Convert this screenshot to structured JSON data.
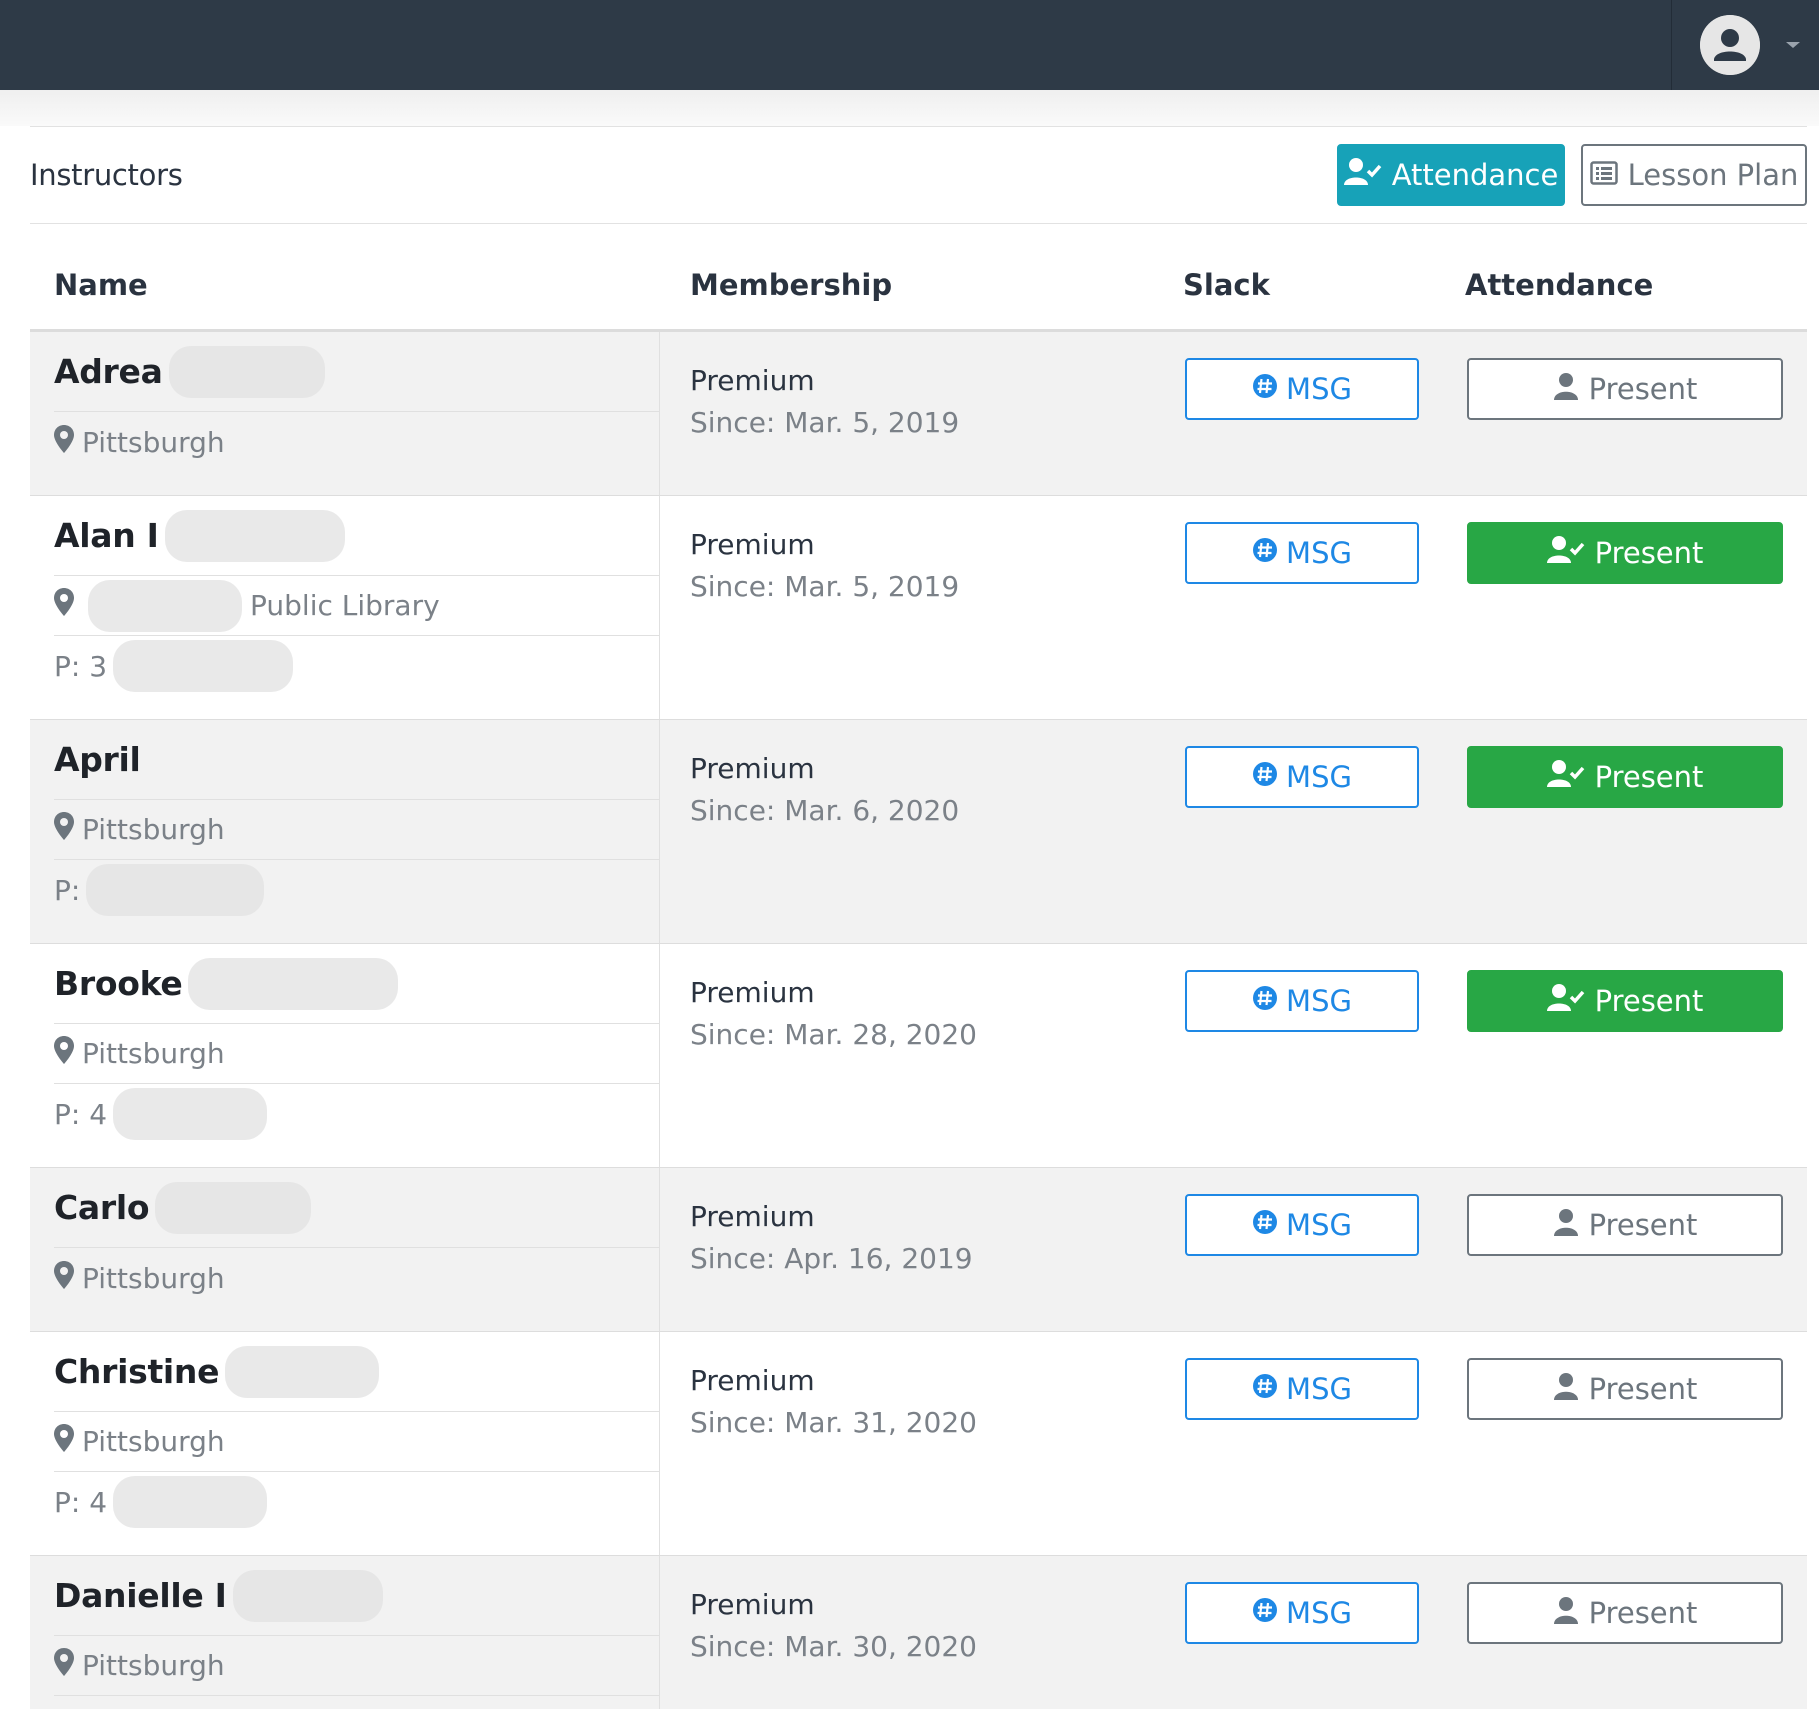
{
  "header": {
    "user_menu": "user-avatar"
  },
  "section": {
    "title": "Instructors",
    "attendance_button": "Attendance",
    "lesson_plan_button": "Lesson Plan"
  },
  "table": {
    "columns": [
      "Name",
      "Membership",
      "Slack",
      "Attendance"
    ]
  },
  "instructors": [
    {
      "name": "Adrea",
      "location": "Pittsburgh",
      "membership": "Premium",
      "since": "Since: Mar. 5, 2019",
      "msg": "MSG",
      "present": "Present",
      "present_state": "not-marked"
    },
    {
      "name": "Alan I",
      "location": "Public Library",
      "phone_prefix": "P: 3",
      "membership": "Premium",
      "since": "Since: Mar. 5, 2019",
      "msg": "MSG",
      "present": "Present",
      "present_state": "marked"
    },
    {
      "name": "April",
      "location": "Pittsburgh",
      "phone_prefix": "P:",
      "membership": "Premium",
      "since": "Since: Mar. 6, 2020",
      "msg": "MSG",
      "present": "Present",
      "present_state": "marked"
    },
    {
      "name": "Brooke",
      "location": "Pittsburgh",
      "phone_prefix": "P: 4",
      "membership": "Premium",
      "since": "Since: Mar. 28, 2020",
      "msg": "MSG",
      "present": "Present",
      "present_state": "marked"
    },
    {
      "name": "Carlo",
      "location": "Pittsburgh",
      "membership": "Premium",
      "since": "Since: Apr. 16, 2019",
      "msg": "MSG",
      "present": "Present",
      "present_state": "not-marked"
    },
    {
      "name": "Christine",
      "location": "Pittsburgh",
      "phone_prefix": "P: 4",
      "membership": "Premium",
      "since": "Since: Mar. 31, 2020",
      "msg": "MSG",
      "present": "Present",
      "present_state": "not-marked"
    },
    {
      "name": "Danielle I",
      "location": "Pittsburgh",
      "membership": "Premium",
      "since": "Since: Mar. 30, 2020",
      "msg": "MSG",
      "present": "Present",
      "present_state": "not-marked"
    }
  ],
  "colors": {
    "topbar": "#2e3a47",
    "attendance_button": "#17a2b8",
    "present_marked": "#28a745",
    "slack_msg": "#1e88e5"
  },
  "icons": {
    "avatar": "user-avatar-icon",
    "caret": "caret-down-icon",
    "attendance": "user-check-icon",
    "lesson_plan": "list-alt-icon",
    "location": "map-marker-icon",
    "slack": "slack-icon",
    "present_off": "user-icon",
    "present_on": "user-check-icon"
  }
}
